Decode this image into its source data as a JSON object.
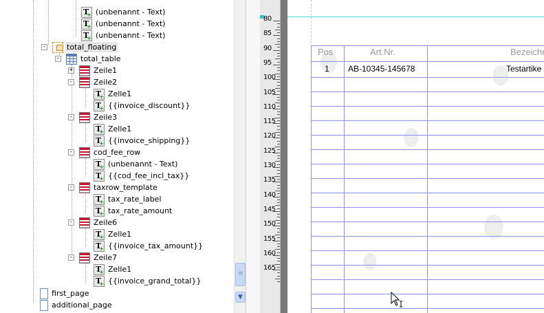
{
  "tree": {
    "items": [
      {
        "label": "(unbenannt - Text)",
        "icon": "text-icon"
      },
      {
        "label": "(unbenannt - Text)",
        "icon": "text-icon"
      },
      {
        "label": "(unbenannt - Text)",
        "icon": "text-icon"
      },
      {
        "label": "total_floating",
        "icon": "floating-frame-icon",
        "selected": true
      },
      {
        "label": "total_table",
        "icon": "table-icon"
      },
      {
        "label": "Zeile1",
        "icon": "row-icon"
      },
      {
        "label": "Zeile2",
        "icon": "row-icon"
      },
      {
        "label": "Zelle1",
        "icon": "text-icon"
      },
      {
        "label": "{{invoice_discount}}",
        "icon": "text-icon"
      },
      {
        "label": "Zeile3",
        "icon": "row-icon"
      },
      {
        "label": "Zelle1",
        "icon": "text-icon"
      },
      {
        "label": "{{invoice_shipping}}",
        "icon": "text-icon"
      },
      {
        "label": "cod_fee_row",
        "icon": "row-icon"
      },
      {
        "label": "(unbenannt - Text)",
        "icon": "text-icon"
      },
      {
        "label": "{{cod_fee_incl_tax}}",
        "icon": "text-icon"
      },
      {
        "label": "taxrow_template",
        "icon": "row-icon"
      },
      {
        "label": "tax_rate_label",
        "icon": "text-icon"
      },
      {
        "label": "tax_rate_amount",
        "icon": "text-icon"
      },
      {
        "label": "Zeile6",
        "icon": "row-icon"
      },
      {
        "label": "Zelle1",
        "icon": "text-icon"
      },
      {
        "label": "{{invoice_tax_amount}}",
        "icon": "text-icon"
      },
      {
        "label": "Zeile7",
        "icon": "row-icon"
      },
      {
        "label": "Zelle1",
        "icon": "text-icon"
      },
      {
        "label": "{{invoice_grand_total}}",
        "icon": "text-icon"
      },
      {
        "label": "first_page",
        "icon": "page-icon"
      },
      {
        "label": "additional_page",
        "icon": "page-icon"
      }
    ],
    "toggles": [
      "-",
      "-",
      "+",
      "-",
      "-",
      "-",
      "-",
      "-",
      "-"
    ]
  },
  "ruler": {
    "numbers": [
      "80",
      "85",
      "90",
      "95",
      "100",
      "105",
      "110",
      "115",
      "120",
      "125",
      "130",
      "135",
      "140",
      "145",
      "150",
      "155",
      "160",
      "165"
    ]
  },
  "table": {
    "headers": [
      "Pos",
      "Art.Nr.",
      "Bezeichnu"
    ],
    "row1": [
      "1",
      "AB-10345-145678",
      "Testartike"
    ]
  },
  "colors": {
    "grid_line": "#8b8fe6",
    "guide_line": "#41d9d9",
    "selection_bg": "#e6e6e6"
  }
}
